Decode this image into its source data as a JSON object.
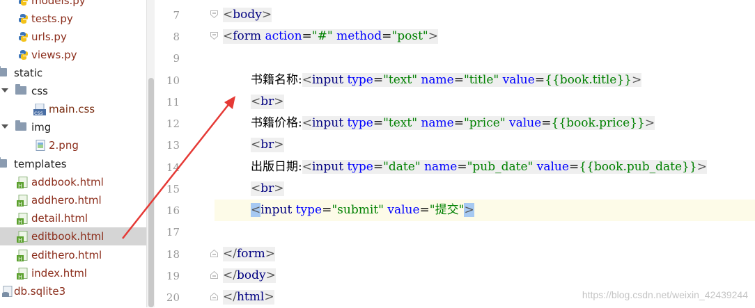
{
  "tree": {
    "items": [
      {
        "label": "models.py",
        "kind": "py"
      },
      {
        "label": "tests.py",
        "kind": "py"
      },
      {
        "label": "urls.py",
        "kind": "py"
      },
      {
        "label": "views.py",
        "kind": "py"
      },
      {
        "label": "static",
        "kind": "folder-root"
      },
      {
        "label": "css",
        "kind": "folder"
      },
      {
        "label": "main.css",
        "kind": "css"
      },
      {
        "label": "img",
        "kind": "folder"
      },
      {
        "label": "2.png",
        "kind": "image"
      },
      {
        "label": "templates",
        "kind": "folder-root"
      },
      {
        "label": "addbook.html",
        "kind": "html"
      },
      {
        "label": "addhero.html",
        "kind": "html"
      },
      {
        "label": "detail.html",
        "kind": "html"
      },
      {
        "label": "editbook.html",
        "kind": "html",
        "selected": true
      },
      {
        "label": "edithero.html",
        "kind": "html"
      },
      {
        "label": "index.html",
        "kind": "html"
      },
      {
        "label": "db.sqlite3",
        "kind": "db"
      }
    ]
  },
  "editor": {
    "current_line": "16",
    "lines": [
      {
        "num": "7",
        "a": "<",
        "b": "body",
        "c": ">"
      },
      {
        "num": "8",
        "a": "<",
        "b": "form",
        "c": " ",
        "d": "action",
        "e": "=",
        "f": "\"#\"",
        "g": " ",
        "h": "method",
        "i": "=",
        "j": "\"post\"",
        "k": ">"
      },
      {
        "num": "9"
      },
      {
        "num": "10",
        "a": "书籍名称:",
        "b": "<",
        "c": "input",
        "d": " ",
        "e": "type",
        "f": "=",
        "g": "\"text\"",
        "h": " ",
        "i": "name",
        "j": "=",
        "k": "\"title\"",
        "l": " ",
        "m": "value",
        "n": "=",
        "o": "{{book.title}}",
        "p": ">"
      },
      {
        "num": "11",
        "a": "<",
        "b": "br",
        "c": ">"
      },
      {
        "num": "12",
        "a": "书籍价格:",
        "b": "<",
        "c": "input",
        "d": " ",
        "e": "type",
        "f": "=",
        "g": "\"text\"",
        "h": " ",
        "i": "name",
        "j": "=",
        "k": "\"price\"",
        "l": " ",
        "m": "value",
        "n": "=",
        "o": "{{book.price}}",
        "p": ">"
      },
      {
        "num": "13",
        "a": "<",
        "b": "br",
        "c": ">"
      },
      {
        "num": "14",
        "a": "出版日期:",
        "b": "<",
        "c": "input",
        "d": " ",
        "e": "type",
        "f": "=",
        "g": "\"date\"",
        "h": " ",
        "i": "name",
        "j": "=",
        "k": "\"pub_date\"",
        "l": " ",
        "m": "value",
        "n": "=",
        "o": "{{book.pub_date}}",
        "p": ">"
      },
      {
        "num": "15",
        "a": "<",
        "b": "br",
        "c": ">"
      },
      {
        "num": "16",
        "a": "<",
        "b": "input",
        "c": " ",
        "d": "type",
        "e": "=",
        "f": "\"submit\"",
        "g": " ",
        "h": "value",
        "i": "=",
        "j": "\"提交\"",
        "k": ">"
      },
      {
        "num": "17"
      },
      {
        "num": "18",
        "a": "</",
        "b": "form",
        "c": ">"
      },
      {
        "num": "19",
        "a": "</",
        "b": "body",
        "c": ">"
      },
      {
        "num": "20",
        "a": "</",
        "b": "html",
        "c": ">"
      }
    ]
  },
  "watermark": "https://blog.csdn.net/weixin_42439244",
  "colors": {
    "selected_row": "#d5d5d5",
    "current_line": "#fdfbe8",
    "arrow": "#e53935",
    "tag": "#000080",
    "attr": "#0000ff",
    "value": "#008000"
  }
}
